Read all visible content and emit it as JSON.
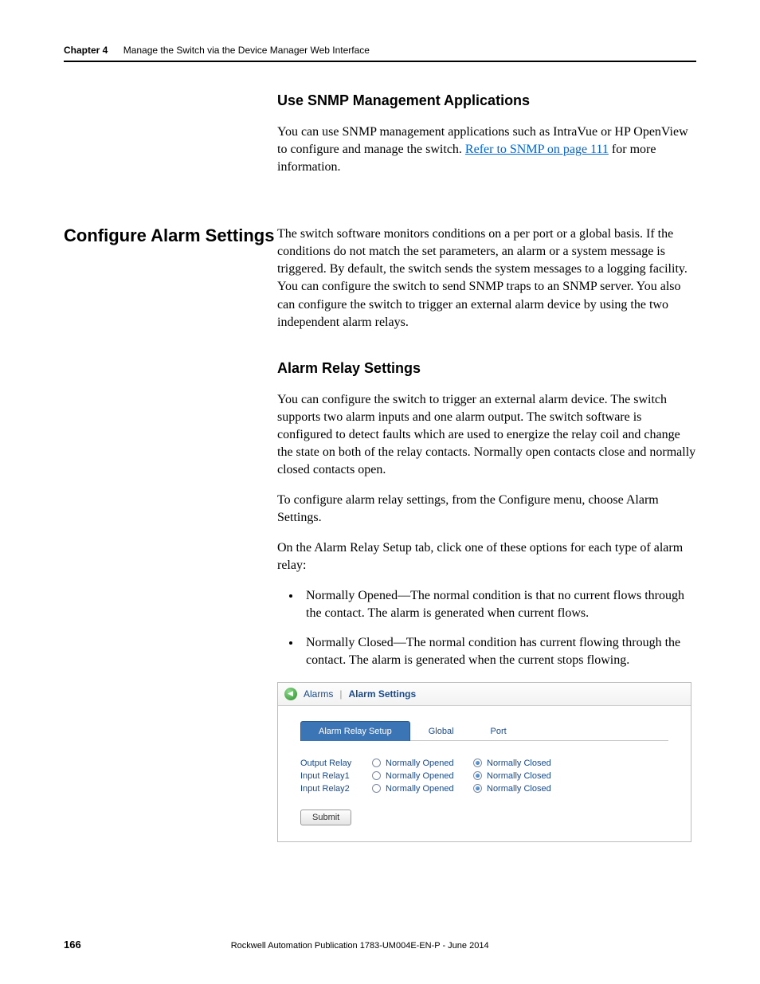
{
  "header": {
    "chapter": "Chapter 4",
    "title": "Manage the Switch via the Device Manager Web Interface"
  },
  "sections": {
    "snmp": {
      "heading": "Use SNMP Management Applications",
      "p1_a": "You can use SNMP management applications such as IntraVue or HP OpenView to configure and manage the switch. ",
      "p1_link": "Refer to SNMP on page 111",
      "p1_b": " for more information."
    },
    "configure": {
      "heading": "Configure Alarm Settings",
      "p1": "The switch software monitors conditions on a per port or a global basis. If the conditions do not match the set parameters, an alarm or a system message is triggered. By default, the switch sends the system messages to a logging facility. You can configure the switch to send SNMP traps to an SNMP server. You also can configure the switch to trigger an external alarm device by using the two independent alarm relays."
    },
    "alarm_relay": {
      "heading": "Alarm Relay Settings",
      "p1": "You can configure the switch to trigger an external alarm device. The switch supports two alarm inputs and one alarm output. The switch software is configured to detect faults which are used to energize the relay coil and change the state on both of the relay contacts. Normally open contacts close and normally closed contacts open.",
      "p2": "To configure alarm relay settings, from the Configure menu, choose Alarm Settings.",
      "p3": "On the Alarm Relay Setup tab, click one of these options for each type of alarm relay:",
      "bullets": [
        "Normally Opened—The normal condition is that no current flows through the contact. The alarm is generated when current flows.",
        "Normally Closed—The normal condition has current flowing through the contact. The alarm is generated when the current stops flowing."
      ]
    }
  },
  "figure": {
    "breadcrumb_parent": "Alarms",
    "breadcrumb_sep": "|",
    "breadcrumb_current": "Alarm Settings",
    "tabs": [
      "Alarm Relay Setup",
      "Global",
      "Port"
    ],
    "active_tab": 0,
    "option_open": "Normally Opened",
    "option_closed": "Normally Closed",
    "rows": [
      {
        "label": "Output Relay",
        "selected": "closed"
      },
      {
        "label": "Input Relay1",
        "selected": "closed"
      },
      {
        "label": "Input Relay2",
        "selected": "closed"
      }
    ],
    "submit": "Submit"
  },
  "footer": {
    "page": "166",
    "pub": "Rockwell Automation Publication 1783-UM004E-EN-P - June 2014"
  }
}
